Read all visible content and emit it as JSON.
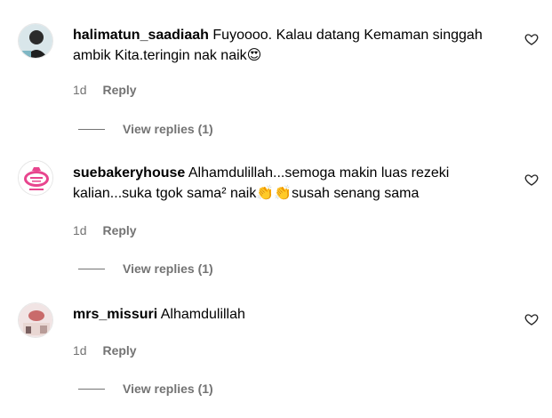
{
  "comments": [
    {
      "username": "halimatun_saadiaah",
      "text": "Fuyoooo. Kalau datang Kemaman singgah ambik Kita.teringin nak naik",
      "emoji": "😍",
      "time": "1d",
      "reply_label": "Reply",
      "view_replies": "View replies (1)"
    },
    {
      "username": "suebakeryhouse",
      "text": "Alhamdulillah...semoga makin luas rezeki kalian...suka tgok sama² naik",
      "emoji": "👏👏",
      "text_after": "susah senang sama",
      "time": "1d",
      "reply_label": "Reply",
      "view_replies": "View replies (1)"
    },
    {
      "username": "mrs_missuri",
      "text": "Alhamdulillah",
      "time": "1d",
      "reply_label": "Reply",
      "view_replies": "View replies (1)"
    }
  ],
  "colors": {
    "secondary_text": "#737373",
    "primary_text": "#000000",
    "emoji_clap": "#f5c518",
    "emoji_heart_eyes": "#e0332c"
  }
}
